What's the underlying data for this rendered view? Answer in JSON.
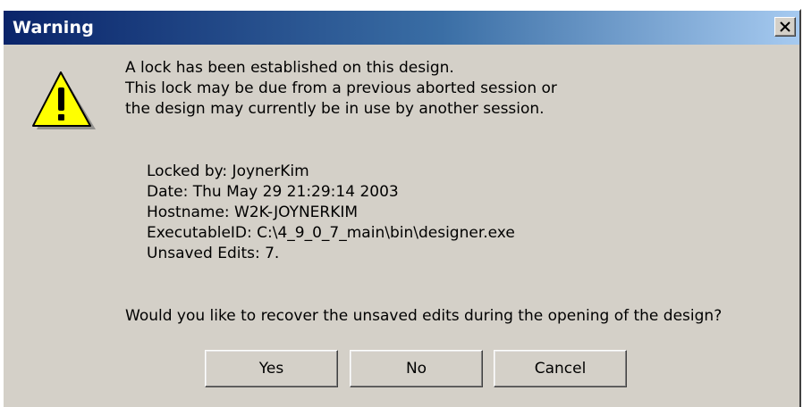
{
  "window": {
    "title": "Warning",
    "close_label": "close",
    "icon": "warning-triangle-icon"
  },
  "message": {
    "lines": [
      "A lock has been established on this design.",
      "This lock may be due from a previous aborted session or",
      "the design may currently be in use by another session."
    ]
  },
  "details": {
    "locked_by": "Locked by: JoynerKim",
    "date": "Date: Thu May 29 21:29:14 2003",
    "hostname": "Hostname: W2K-JOYNERKIM",
    "executable_id": "ExecutableID: C:\\4_9_0_7_main\\bin\\designer.exe",
    "unsaved_edits": "Unsaved Edits: 7."
  },
  "question": "Would you like to recover the unsaved edits during the opening of the design?",
  "buttons": {
    "yes": "Yes",
    "no": "No",
    "cancel": "Cancel"
  },
  "colors": {
    "titlebar_start": "#0a246a",
    "titlebar_end": "#a6caf0",
    "dialog_bg": "#d4d0c8",
    "warning_yellow": "#ffff00"
  }
}
